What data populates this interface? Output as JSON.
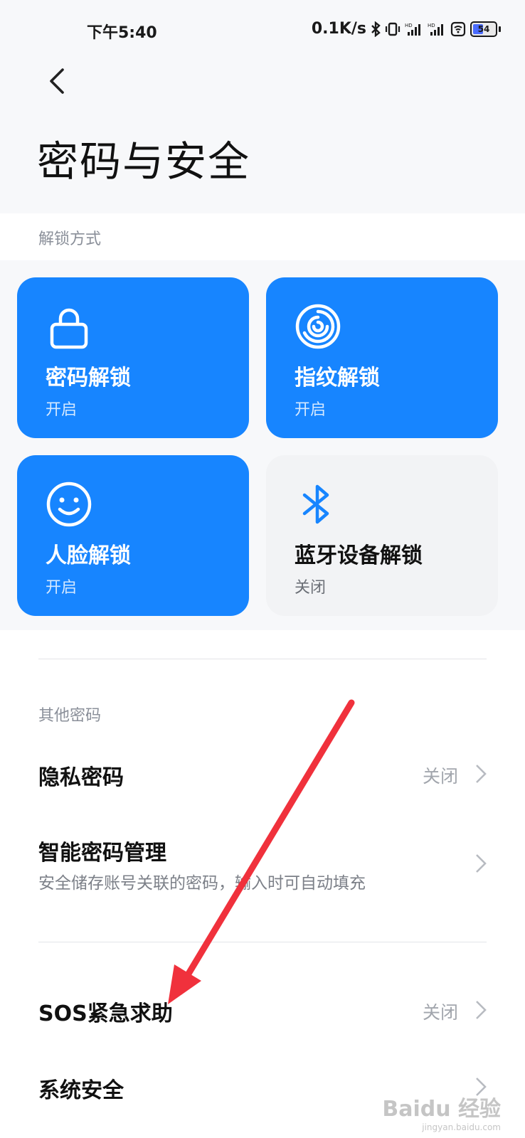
{
  "status_bar": {
    "time": "下午5:40",
    "net_speed": "0.1K/s",
    "battery": "54",
    "battery_level": 0.54
  },
  "header": {
    "title": "密码与安全"
  },
  "unlock": {
    "section_label": "解锁方式",
    "tiles": [
      {
        "title": "密码解锁",
        "status": "开启",
        "icon": "lock-icon",
        "enabled": true
      },
      {
        "title": "指纹解锁",
        "status": "开启",
        "icon": "fingerprint-icon",
        "enabled": true
      },
      {
        "title": "人脸解锁",
        "status": "开启",
        "icon": "face-icon",
        "enabled": true
      },
      {
        "title": "蓝牙设备解锁",
        "status": "关闭",
        "icon": "bluetooth-icon",
        "enabled": false
      }
    ]
  },
  "other": {
    "section_label": "其他密码",
    "items": [
      {
        "title": "隐私密码",
        "value": "关闭"
      },
      {
        "title": "智能密码管理",
        "subtitle": "安全储存账号关联的密码，输入时可自动填充"
      }
    ]
  },
  "more": {
    "items": [
      {
        "title": "SOS紧急求助",
        "value": "关闭"
      },
      {
        "title": "系统安全"
      }
    ]
  },
  "watermark": {
    "brand": "Baidu 经验",
    "url": "jingyan.baidu.com"
  },
  "colors": {
    "accent": "#1785ff",
    "annotation_arrow": "#f0313c",
    "background": "#f7f8fa"
  }
}
